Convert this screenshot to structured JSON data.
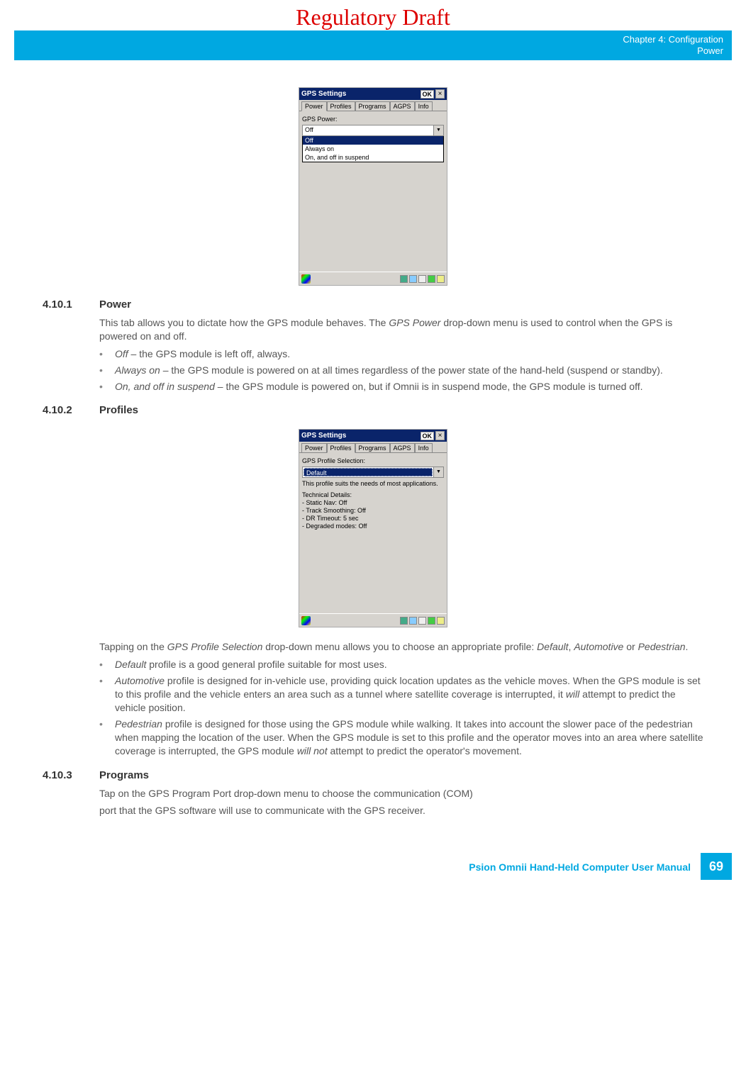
{
  "watermark": "Regulatory Draft",
  "header": {
    "line1": "Chapter 4:  Configuration",
    "line2": "Power"
  },
  "device1": {
    "title": "GPS Settings",
    "ok": "OK",
    "tabs": [
      "Power",
      "Profiles",
      "Programs",
      "AGPS",
      "Info"
    ],
    "active_tab": "Power",
    "label": "GPS Power:",
    "value": "Off",
    "options": [
      "Off",
      "Always on",
      "On, and off in suspend"
    ],
    "selected_option": "Off"
  },
  "device2": {
    "title": "GPS Settings",
    "ok": "OK",
    "tabs": [
      "Power",
      "Profiles",
      "Programs",
      "AGPS",
      "Info"
    ],
    "active_tab": "Profiles",
    "label": "GPS Profile Selection:",
    "value": "Default",
    "desc": "This profile suits the needs of most applications.",
    "tech_head": "Technical Details:",
    "tech": [
      "- Static Nav: Off",
      "- Track Smoothing: Off",
      "- DR Timeout: 5 sec",
      "- Degraded modes: Off"
    ]
  },
  "s4101": {
    "num": "4.10.1",
    "title": "Power",
    "p1a": "This tab allows you to dictate how the GPS module behaves. The ",
    "p1b": "GPS Power",
    "p1c": " drop-down menu is used to control when the GPS is powered on and off.",
    "b1a": "Off",
    "b1b": " – the GPS module is left off, always.",
    "b2a": " Always on",
    "b2b": " – the GPS module is powered on at all times regardless of the power state of the hand-held (suspend or standby).",
    "b3a": "On, and off in suspend",
    "b3b": " – the GPS module is powered on, but if Omnii is in suspend mode, the GPS module is turned off."
  },
  "s4102": {
    "num": "4.10.2",
    "title": "Profiles",
    "p1a": "Tapping on the ",
    "p1b": "GPS Profile Selection",
    "p1c": " drop-down menu allows you to choose an appropriate profile: ",
    "p1d": "Default",
    "p1e": ", ",
    "p1f": "Automotive",
    "p1g": " or ",
    "p1h": "Pedestrian",
    "p1i": ".",
    "b1a": "Default",
    "b1b": " profile is a good general profile suitable for most uses.",
    "b2a": "Automotive",
    "b2b": " profile is designed for in-vehicle use, providing quick location updates as the vehicle moves. When the GPS module is set to this profile and the vehicle enters an area such as a tunnel where satellite coverage is interrupted, it ",
    "b2c": "will",
    "b2d": " attempt to predict the vehicle position.",
    "b3a": "Pedestrian",
    "b3b": " profile is designed for those using the GPS module while walking. It takes into account the slower pace of the pedestrian when mapping the location of the user. When the GPS module is set to this profile and the operator moves into an area where satellite coverage is interrupted, the GPS module ",
    "b3c": "will not",
    "b3d": " attempt to predict the operator's movement."
  },
  "s4103": {
    "num": "4.10.3",
    "title": "Programs",
    "p1": "Tap on the GPS Program Port drop-down menu to choose the communication (COM)",
    "p2": "port that the GPS software will use to communicate with the GPS receiver."
  },
  "footer": {
    "label": "Psion Omnii Hand-Held Computer User Manual",
    "page": "69"
  }
}
